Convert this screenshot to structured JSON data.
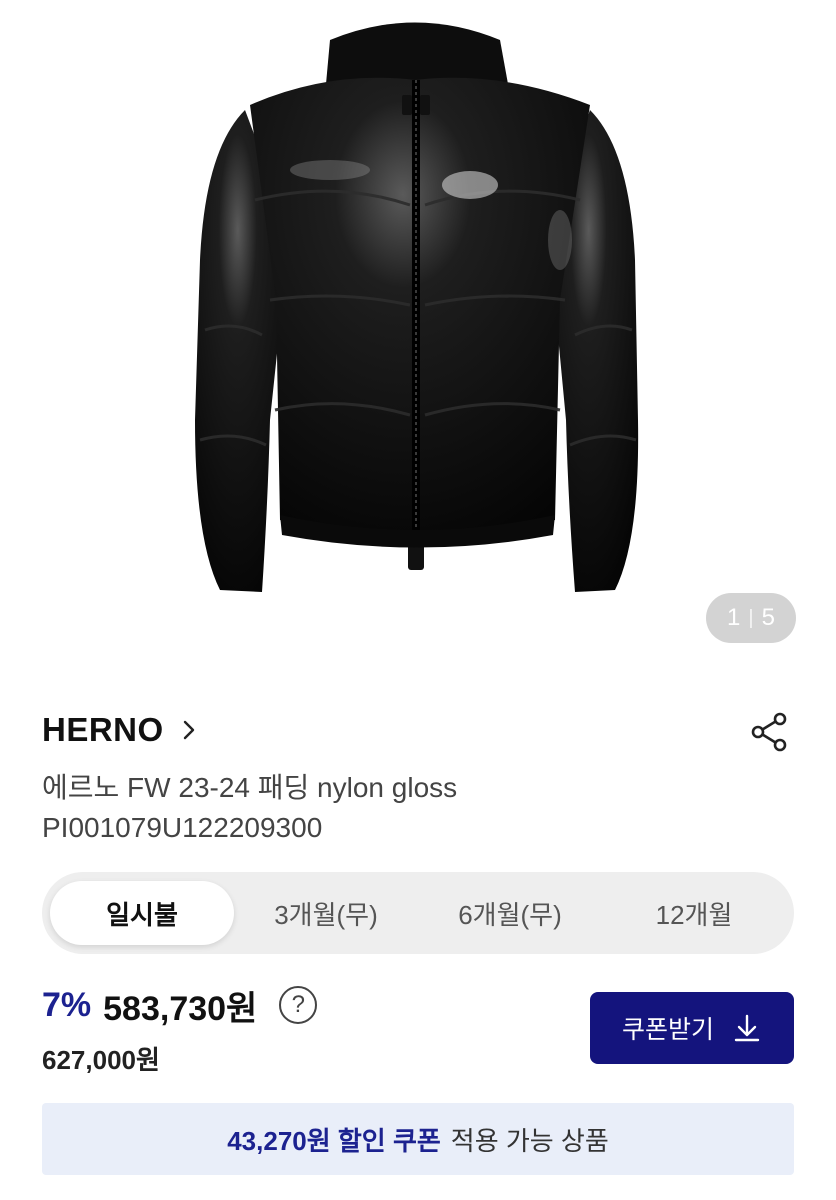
{
  "product_image": {
    "icon": "black-gloss-puffer-jacket-image",
    "counter_current": "1",
    "counter_total": "5"
  },
  "brand": {
    "name": "HERNO"
  },
  "product": {
    "title": "에르노 FW 23-24 패딩 nylon gloss",
    "code": "PI001079U122209300"
  },
  "installment_tabs": [
    {
      "label": "일시불",
      "active": true
    },
    {
      "label": "3개월(무)",
      "active": false
    },
    {
      "label": "6개월(무)",
      "active": false
    },
    {
      "label": "12개월",
      "active": false
    }
  ],
  "pricing": {
    "discount_rate": "7%",
    "sale_price": "583,730원",
    "original_price": "627,000원"
  },
  "coupon_button": {
    "label": "쿠폰받기"
  },
  "coupon_banner": {
    "highlight": "43,270원 할인 쿠폰",
    "rest": "적용 가능 상품"
  },
  "colors": {
    "accent": "#1c2290",
    "button": "#14147d",
    "banner_bg": "#e9eef9"
  }
}
